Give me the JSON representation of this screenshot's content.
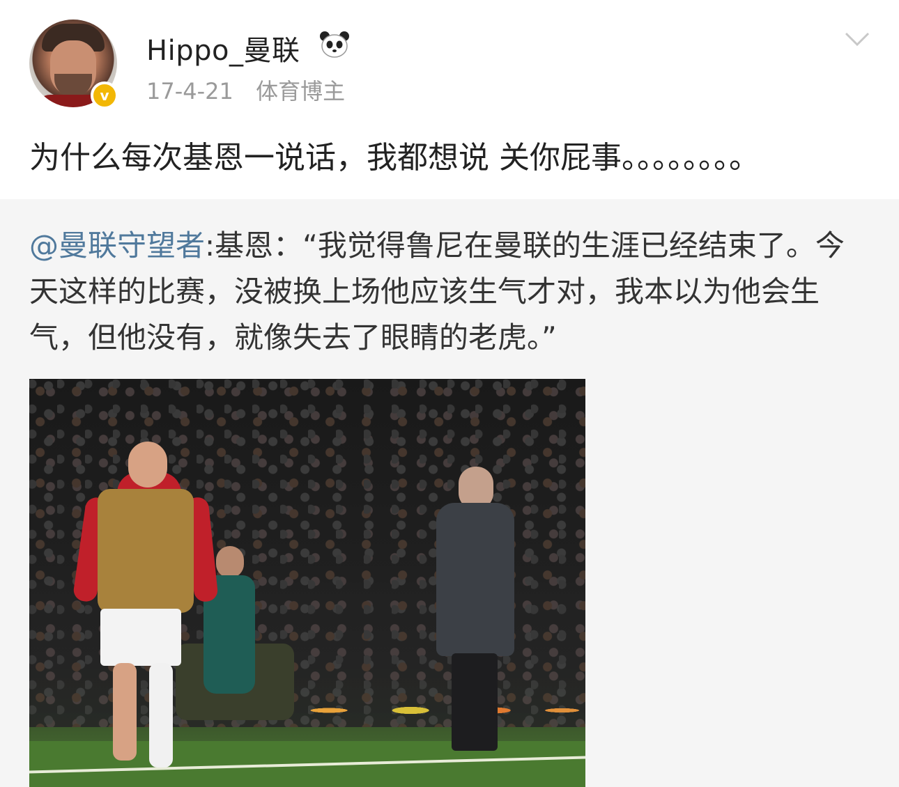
{
  "post": {
    "username": "Hippo_曼联",
    "time": "17-4-21",
    "tag": "体育博主",
    "verified_mark": "v",
    "text": "为什么每次基恩一说话，我都想说 关你屁事。。。。。。。。",
    "icons": [
      "verified-badge-icon",
      "panda-emoji-icon",
      "chevron-down-icon"
    ]
  },
  "repost": {
    "mention": "@曼联守望者",
    "body": ":基恩：“我觉得鲁尼在曼联的生涯已经结束了。今天这样的比赛，没被换上场他应该生气才对，我本以为他会生气，但他没有，就像失去了眼睛的老虎。”"
  },
  "colors": {
    "mention": "#50799c",
    "repost_background": "#f5f5f5",
    "verified_badge": "#f2b705",
    "meta_text": "#9a9a9a"
  }
}
